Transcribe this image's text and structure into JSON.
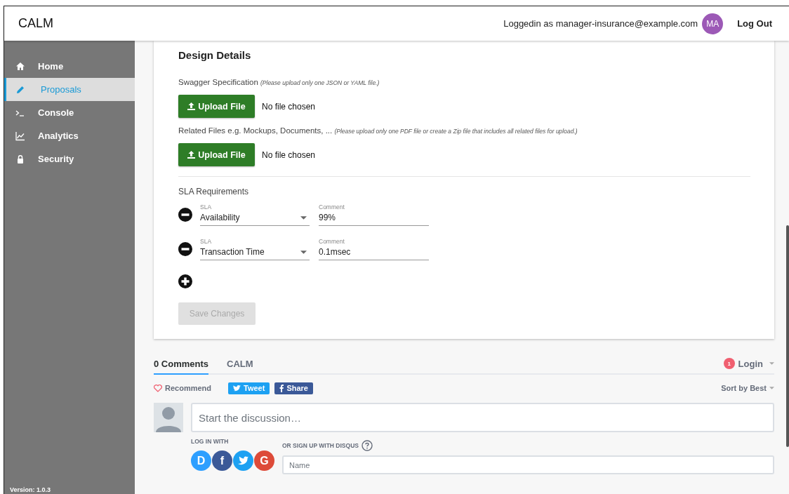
{
  "header": {
    "brand": "CALM",
    "login_text": "Loggedin as manager-insurance@example.com",
    "avatar_initials": "MA",
    "logout": "Log Out"
  },
  "sidebar": {
    "items": [
      {
        "label": "Home",
        "selected": false
      },
      {
        "label": "Proposals",
        "selected": true
      },
      {
        "label": "Console",
        "selected": false
      },
      {
        "label": "Analytics",
        "selected": false
      },
      {
        "label": "Security",
        "selected": false
      }
    ],
    "version": "Version: 1.0.3"
  },
  "design": {
    "title": "Design Details",
    "uploads": [
      {
        "label": "Swagger Specification",
        "note": "(Please upload only one JSON or YAML file.)",
        "button": "Upload File",
        "status": "No file chosen"
      },
      {
        "label": "Related Files e.g. Mockups, Documents, ...",
        "note": "(Please upload only one PDF file or create a Zip file that includes all related files for upload.)",
        "button": "Upload File",
        "status": "No file chosen"
      }
    ],
    "sla_title": "SLA Requirements",
    "sla_rows": [
      {
        "sla_label": "SLA",
        "sla": "Availability",
        "comment_label": "Comment",
        "comment": "99%"
      },
      {
        "sla_label": "SLA",
        "sla": "Transaction Time",
        "comment_label": "Comment",
        "comment": "0.1msec"
      }
    ],
    "save": {
      "label": "Save Changes",
      "disabled": true
    }
  },
  "comments": {
    "tabs": [
      {
        "label": "0 Comments",
        "selected": true
      },
      {
        "label": "CALM",
        "selected": false
      }
    ],
    "login": {
      "label": "Login",
      "badge": "1"
    },
    "recommend": "Recommend",
    "tweet": "Tweet",
    "share": "Share",
    "sort": "Sort by Best",
    "placeholder": "Start the discussion…",
    "login_with": "LOG IN WITH",
    "providers": [
      {
        "kind": "letter",
        "label": "D",
        "color": "#2e9fff"
      },
      {
        "kind": "letter",
        "label": "f",
        "color": "#3b5998"
      },
      {
        "kind": "bird",
        "color": "#1da1f2"
      },
      {
        "kind": "letter",
        "label": "G",
        "color": "#dd4b39"
      }
    ],
    "signup": "OR SIGN UP WITH DISQUS",
    "name_placeholder": "Name"
  }
}
